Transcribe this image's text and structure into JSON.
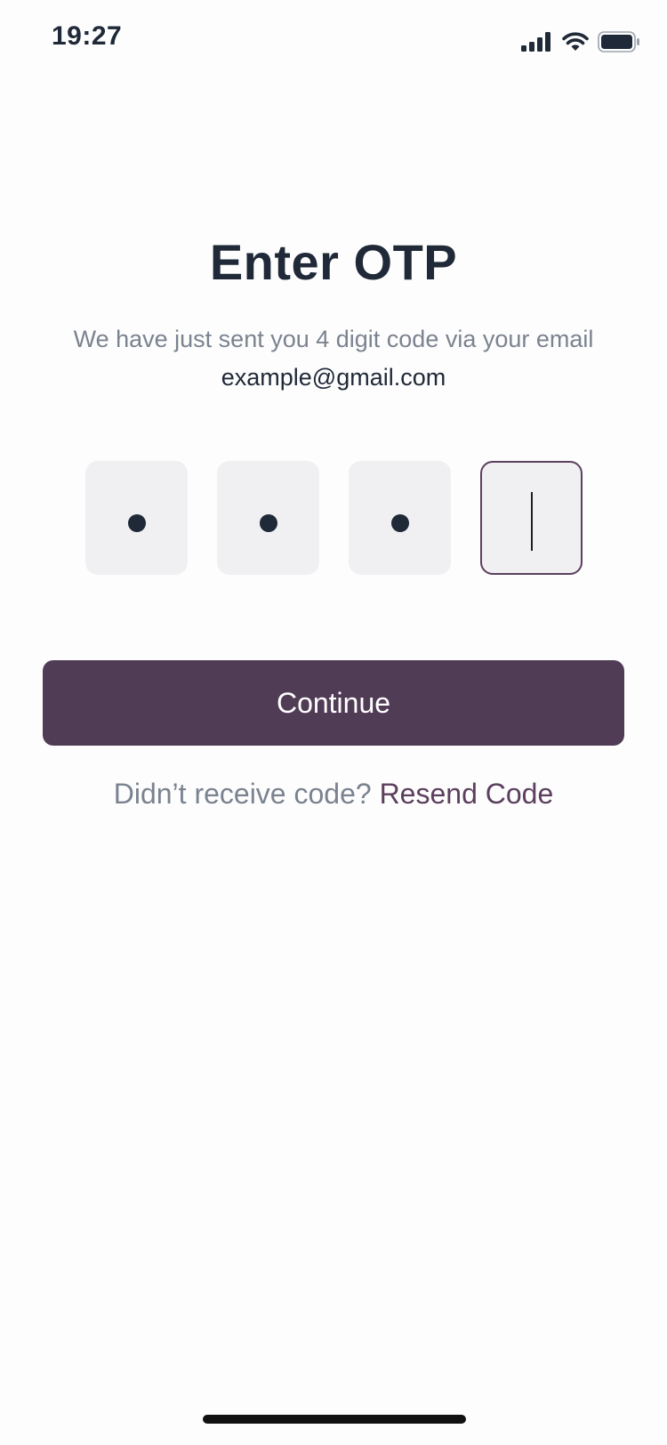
{
  "status_bar": {
    "time": "19:27",
    "icons": [
      "cellular-signal-icon",
      "wifi-icon",
      "battery-icon"
    ]
  },
  "screen": {
    "title": "Enter OTP",
    "subtitle_text": "We have just sent you 4 digit code via your email",
    "email": "example@gmail.com",
    "otp": {
      "length": 4,
      "filled_count": 3,
      "active_index": 3
    },
    "continue_label": "Continue",
    "resend_prompt": "Didn’t receive code?",
    "resend_link": "Resend Code"
  },
  "colors": {
    "primary": "#513C56",
    "accent": "#5C3F5E",
    "text_dark": "#1F2937",
    "text_muted": "#7B8390",
    "otp_box_bg": "#F0F0F2",
    "background": "#FDFDFD"
  }
}
